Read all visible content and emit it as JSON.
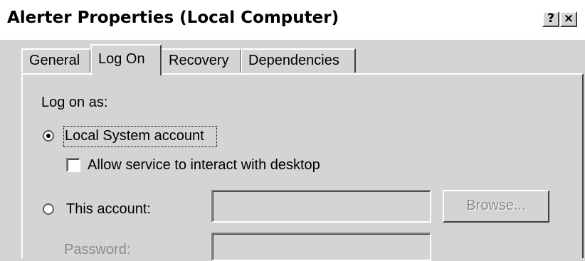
{
  "window": {
    "title": "Alerter Properties (Local Computer)",
    "help_button": "?",
    "close_button": "×"
  },
  "tabs": [
    {
      "label": "General",
      "active": false
    },
    {
      "label": "Log On",
      "active": true
    },
    {
      "label": "Recovery",
      "active": false
    },
    {
      "label": "Dependencies",
      "active": false
    }
  ],
  "logon": {
    "section_label": "Log on as:",
    "local_system_label": "Local System account",
    "local_system_selected": true,
    "interact_desktop_label": "Allow service to interact with desktop",
    "interact_desktop_checked": false,
    "this_account_label": "This account:",
    "this_account_selected": false,
    "this_account_value": "",
    "password_label": "Password:",
    "password_value": "",
    "browse_label": "Browse..."
  }
}
